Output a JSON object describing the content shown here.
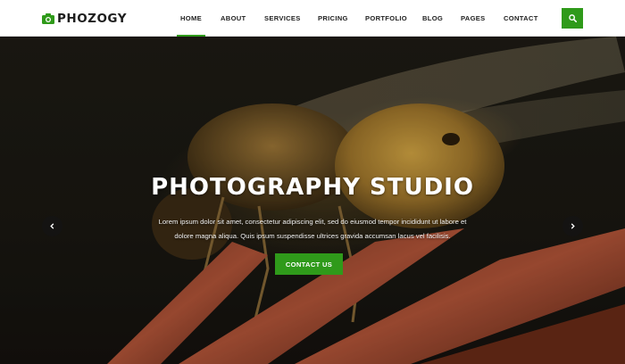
{
  "brand": {
    "name": "PHOZOGY",
    "icon": "camera-icon",
    "accent": "#2f9a1a"
  },
  "nav": {
    "items": [
      {
        "label": "HOME",
        "active": true
      },
      {
        "label": "ABOUT"
      },
      {
        "label": "SERVICES"
      },
      {
        "label": "PRICING"
      },
      {
        "label": "PORTFOLIO"
      },
      {
        "label": "BLOG"
      },
      {
        "label": "PAGES"
      },
      {
        "label": "CONTACT"
      }
    ],
    "search_icon": "search-icon"
  },
  "hero": {
    "title": "PHOTOGRAPHY STUDIO",
    "line1": "Lorem ipsum dolor sit amet, consectetur adipiscing elit, sed do eiusmod tempor incididunt ut labore et",
    "line2": "dolore magna aliqua. Quis ipsum suspendisse ultrices gravida accumsan lacus vel facilisis.",
    "cta_label": "CONTACT US",
    "prev_icon": "chevron-left-icon",
    "next_icon": "chevron-right-icon"
  }
}
